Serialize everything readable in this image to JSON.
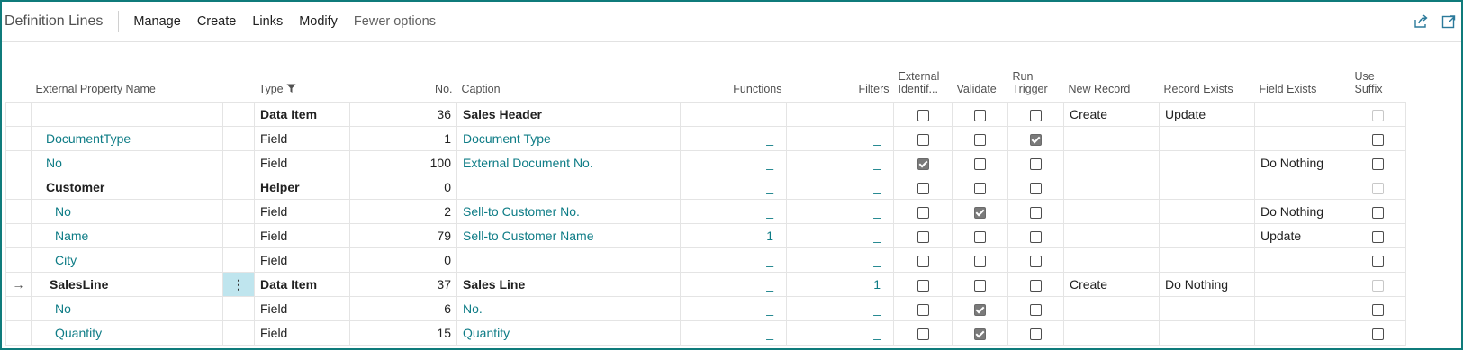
{
  "toolbar": {
    "title": "Definition Lines",
    "actions": [
      "Manage",
      "Create",
      "Links",
      "Modify"
    ],
    "fewer_options": "Fewer options"
  },
  "columns": {
    "external_property_name": "External Property Name",
    "type": "Type",
    "no": "No.",
    "caption": "Caption",
    "functions": "Functions",
    "filters": "Filters",
    "external_identif_line1": "External",
    "external_identif_line2": "Identif...",
    "validate": "Validate",
    "run_trigger_line1": "Run",
    "run_trigger_line2": "Trigger",
    "new_record": "New Record",
    "record_exists": "Record Exists",
    "field_exists": "Field Exists",
    "use_suffix_line1": "Use",
    "use_suffix_line2": "Suffix"
  },
  "rows": [
    {
      "name": "",
      "type": "Data Item",
      "no": "36",
      "caption": "Sales Header",
      "functions": "_",
      "filters": "_",
      "ext_id": false,
      "validate": false,
      "run_trigger": false,
      "new_record": "Create",
      "record_exists": "Update",
      "field_exists": "",
      "use_suffix": false
    },
    {
      "name": "DocumentType",
      "type": "Field",
      "no": "1",
      "caption": "Document Type",
      "functions": "_",
      "filters": "_",
      "ext_id": false,
      "validate": false,
      "run_trigger": true,
      "new_record": "",
      "record_exists": "",
      "field_exists": "",
      "use_suffix": false
    },
    {
      "name": "No",
      "type": "Field",
      "no": "100",
      "caption": "External Document No.",
      "functions": "_",
      "filters": "_",
      "ext_id": true,
      "validate": false,
      "run_trigger": false,
      "new_record": "",
      "record_exists": "",
      "field_exists": "Do Nothing",
      "use_suffix": false
    },
    {
      "name": "Customer",
      "type": "Helper",
      "no": "0",
      "caption": "",
      "functions": "_",
      "filters": "_",
      "ext_id": false,
      "validate": false,
      "run_trigger": false,
      "new_record": "",
      "record_exists": "",
      "field_exists": "",
      "use_suffix": false
    },
    {
      "name": "No",
      "type": "Field",
      "no": "2",
      "caption": "Sell-to Customer No.",
      "functions": "_",
      "filters": "_",
      "ext_id": false,
      "validate": true,
      "run_trigger": false,
      "new_record": "",
      "record_exists": "",
      "field_exists": "Do Nothing",
      "use_suffix": false
    },
    {
      "name": "Name",
      "type": "Field",
      "no": "79",
      "caption": "Sell-to Customer Name",
      "functions": "1",
      "filters": "_",
      "ext_id": false,
      "validate": false,
      "run_trigger": false,
      "new_record": "",
      "record_exists": "",
      "field_exists": "Update",
      "use_suffix": false
    },
    {
      "name": "City",
      "type": "Field",
      "no": "0",
      "caption": "",
      "functions": "_",
      "filters": "_",
      "ext_id": false,
      "validate": false,
      "run_trigger": false,
      "new_record": "",
      "record_exists": "",
      "field_exists": "",
      "use_suffix": false
    },
    {
      "name": "SalesLine",
      "type": "Data Item",
      "no": "37",
      "caption": "Sales Line",
      "functions": "_",
      "filters": "1",
      "ext_id": false,
      "validate": false,
      "run_trigger": false,
      "new_record": "Create",
      "record_exists": "Do Nothing",
      "field_exists": "",
      "use_suffix": false
    },
    {
      "name": "No",
      "type": "Field",
      "no": "6",
      "caption": "No.",
      "functions": "_",
      "filters": "_",
      "ext_id": false,
      "validate": true,
      "run_trigger": false,
      "new_record": "",
      "record_exists": "",
      "field_exists": "",
      "use_suffix": false
    },
    {
      "name": "Quantity",
      "type": "Field",
      "no": "15",
      "caption": "Quantity",
      "functions": "_",
      "filters": "_",
      "ext_id": false,
      "validate": true,
      "run_trigger": false,
      "new_record": "",
      "record_exists": "",
      "field_exists": "",
      "use_suffix": false
    }
  ],
  "current_row_marker": "→",
  "row_menu_glyph": "⋮",
  "colors": {
    "accent": "#0e7c86",
    "frame": "#0f7b7b",
    "selected_cell": "#bfe5ee"
  },
  "icons": [
    "filter-icon",
    "share-icon",
    "expand-icon",
    "arrow-right-icon",
    "more-options-icon"
  ]
}
